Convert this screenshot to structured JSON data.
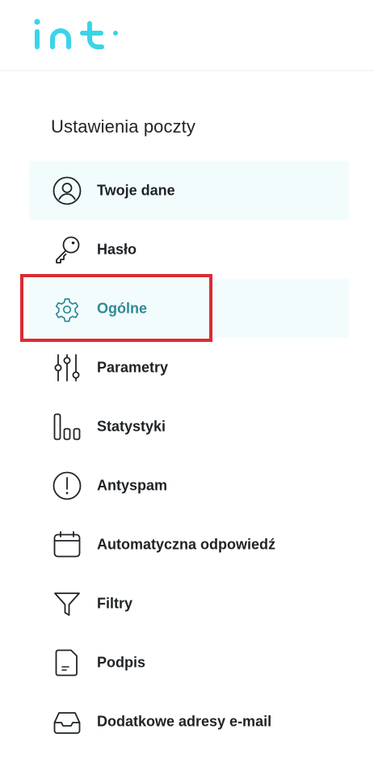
{
  "app": {
    "logo_text": "int",
    "brand_color": "#3ad4e8"
  },
  "sidebar": {
    "title": "Ustawienia poczty",
    "items": [
      {
        "label": "Twoje dane",
        "icon": "user-circle-icon"
      },
      {
        "label": "Hasło",
        "icon": "key-icon"
      },
      {
        "label": "Ogólne",
        "icon": "gear-icon",
        "active": true
      },
      {
        "label": "Parametry",
        "icon": "sliders-icon"
      },
      {
        "label": "Statystyki",
        "icon": "bar-chart-icon"
      },
      {
        "label": "Antyspam",
        "icon": "exclamation-circle-icon"
      },
      {
        "label": "Automatyczna odpowiedź",
        "icon": "calendar-icon"
      },
      {
        "label": "Filtry",
        "icon": "funnel-icon"
      },
      {
        "label": "Podpis",
        "icon": "document-icon"
      },
      {
        "label": "Dodatkowe adresy e-mail",
        "icon": "inbox-tray-icon"
      }
    ]
  },
  "colors": {
    "accent": "#2f8a95",
    "highlight_bg": "#f3fcfd",
    "focus_border": "#dc2b33",
    "text": "#1f2326"
  }
}
